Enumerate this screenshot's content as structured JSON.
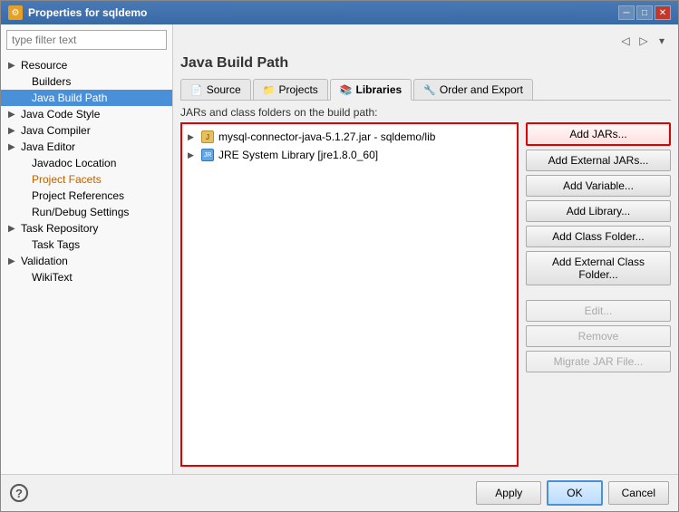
{
  "window": {
    "title": "Properties for sqldemo",
    "icon": "⚙"
  },
  "filter": {
    "placeholder": "type filter text"
  },
  "sidebar": {
    "items": [
      {
        "id": "resource",
        "label": "Resource",
        "indent": false,
        "hasArrow": true,
        "selected": false,
        "orange": false
      },
      {
        "id": "builders",
        "label": "Builders",
        "indent": true,
        "hasArrow": false,
        "selected": false,
        "orange": false
      },
      {
        "id": "java-build-path",
        "label": "Java Build Path",
        "indent": true,
        "hasArrow": false,
        "selected": true,
        "orange": false
      },
      {
        "id": "java-code-style",
        "label": "Java Code Style",
        "indent": false,
        "hasArrow": true,
        "selected": false,
        "orange": false
      },
      {
        "id": "java-compiler",
        "label": "Java Compiler",
        "indent": false,
        "hasArrow": true,
        "selected": false,
        "orange": false
      },
      {
        "id": "java-editor",
        "label": "Java Editor",
        "indent": false,
        "hasArrow": true,
        "selected": false,
        "orange": false
      },
      {
        "id": "javadoc-location",
        "label": "Javadoc Location",
        "indent": true,
        "hasArrow": false,
        "selected": false,
        "orange": false
      },
      {
        "id": "project-facets",
        "label": "Project Facets",
        "indent": true,
        "hasArrow": false,
        "selected": false,
        "orange": true
      },
      {
        "id": "project-references",
        "label": "Project References",
        "indent": true,
        "hasArrow": false,
        "selected": false,
        "orange": false
      },
      {
        "id": "run-debug-settings",
        "label": "Run/Debug Settings",
        "indent": true,
        "hasArrow": false,
        "selected": false,
        "orange": false
      },
      {
        "id": "task-repository",
        "label": "Task Repository",
        "indent": false,
        "hasArrow": true,
        "selected": false,
        "orange": false
      },
      {
        "id": "task-tags",
        "label": "Task Tags",
        "indent": true,
        "hasArrow": false,
        "selected": false,
        "orange": false
      },
      {
        "id": "validation",
        "label": "Validation",
        "indent": false,
        "hasArrow": true,
        "selected": false,
        "orange": false
      },
      {
        "id": "wikitext",
        "label": "WikiText",
        "indent": true,
        "hasArrow": false,
        "selected": false,
        "orange": false
      }
    ]
  },
  "main": {
    "title": "Java Build Path",
    "tabs": [
      {
        "id": "source",
        "label": "Source",
        "icon": "📄",
        "active": false
      },
      {
        "id": "projects",
        "label": "Projects",
        "icon": "📁",
        "active": false
      },
      {
        "id": "libraries",
        "label": "Libraries",
        "icon": "📚",
        "active": true
      },
      {
        "id": "order-export",
        "label": "Order and Export",
        "icon": "🔧",
        "active": false
      }
    ],
    "list_description": "JARs and class folders on the build path:",
    "entries": [
      {
        "id": "mysql-jar",
        "label": "mysql-connector-java-5.1.27.jar - sqldemo/lib",
        "type": "jar",
        "hasArrow": true
      },
      {
        "id": "jre-system",
        "label": "JRE System Library [jre1.8.0_60]",
        "type": "jre",
        "hasArrow": true
      }
    ],
    "buttons": [
      {
        "id": "add-jars",
        "label": "Add JARs...",
        "disabled": false,
        "highlighted": true
      },
      {
        "id": "add-external-jars",
        "label": "Add External JARs...",
        "disabled": false,
        "highlighted": false
      },
      {
        "id": "add-variable",
        "label": "Add Variable...",
        "disabled": false,
        "highlighted": false
      },
      {
        "id": "add-library",
        "label": "Add Library...",
        "disabled": false,
        "highlighted": false
      },
      {
        "id": "add-class-folder",
        "label": "Add Class Folder...",
        "disabled": false,
        "highlighted": false
      },
      {
        "id": "add-external-class-folder",
        "label": "Add External Class Folder...",
        "disabled": false,
        "highlighted": false
      },
      {
        "id": "edit",
        "label": "Edit...",
        "disabled": true,
        "highlighted": false
      },
      {
        "id": "remove",
        "label": "Remove",
        "disabled": true,
        "highlighted": false
      },
      {
        "id": "migrate-jar",
        "label": "Migrate JAR File...",
        "disabled": true,
        "highlighted": false
      }
    ]
  },
  "bottom": {
    "apply_label": "Apply",
    "ok_label": "OK",
    "cancel_label": "Cancel"
  }
}
